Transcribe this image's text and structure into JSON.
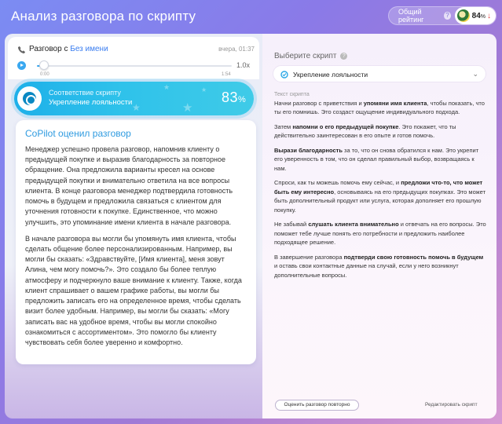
{
  "page": {
    "title": "Анализ разговора по скрипту",
    "rating_label": "Общий рейтинг",
    "rating_help": "?",
    "rating_value": "84",
    "rating_unit": "%",
    "rating_trend": "↓"
  },
  "player": {
    "label_prefix": "Разговор с",
    "contact": "Без имени",
    "timestamp": "вчера, 01:37",
    "speed": "1.0x",
    "time_start": "0:00",
    "time_end": "1:54",
    "progress": 0.02
  },
  "compliance": {
    "line1": "Соответствие скрипту",
    "line2": "Укрепление лояльности",
    "percent": "83",
    "unit": "%"
  },
  "copilot": {
    "title": "CoPilot оценил разговор",
    "paragraph1": "Менеджер успешно провела разговор, напомнив клиенту о предыдущей покупке и выразив благодарность за повторное обращение. Она предложила варианты кресел на основе предыдущей покупки и внимательно ответила на все вопросы клиента. В конце разговора менеджер подтвердила готовность помочь в будущем и предложила связаться с клиентом для уточнения готовности к покупке. Единственное, что можно улучшить, это упоминание имени клиента в начале разговора.",
    "paragraph2": "В начале разговора вы могли бы упомянуть имя клиента, чтобы сделать общение более персонализированным. Например, вы могли бы сказать: «Здравствуйте, [Имя клиента], меня зовут Алина, чем могу помочь?». Это создало бы более теплую атмосферу и подчеркнуло ваше внимание к клиенту. Также, когда клиент спрашивает о вашем графике работы, вы могли бы предложить записать его на определенное время, чтобы сделать визит более удобным. Например, вы могли бы сказать: «Могу записать вас на удобное время, чтобы вы могли спокойно ознакомиться с ассортиментом». Это помогло бы клиенту чувствовать себя более уверенно и комфортно."
  },
  "script": {
    "choose_label": "Выберите скрипт",
    "choose_help": "?",
    "selected": "Укрепление лояльности",
    "text_label": "Текст скрипта",
    "p1": {
      "a": "Начни разговор с приветствия и ",
      "b": "упомяни имя клиента",
      "c": ", чтобы показать, что ты его помнишь. Это создаст ощущение индивидуального подхода."
    },
    "p2": {
      "a": "Затем ",
      "b": "напомни о его предыдущей покупке",
      "c": ". Это покажет, что ты действительно заинтересован в его опыте и готов помочь."
    },
    "p3": {
      "a": "",
      "b": "Вырази благодарность",
      "c": " за то, что он снова обратился к нам. Это укрепит его уверенность в том, что он сделал правильный выбор, возвращаясь к нам."
    },
    "p4": {
      "a": "Спроси, как ты можешь помочь ему сейчас, и ",
      "b": "предложи что-то, что может быть ему интересно",
      "c": ", основываясь на его предыдущих покупках. Это может быть дополнительный продукт или услуга, которая дополняет его прошлую покупку."
    },
    "p5": {
      "a": "Не забывай ",
      "b": "слушать клиента внимательно",
      "c": " и отвечать на его вопросы. Это поможет тебе лучше понять его потребности и предложить наиболее подходящее решение."
    },
    "p6": {
      "a": "В завершение разговора ",
      "b": "подтверди свою готовность помочь в будущем",
      "c": " и оставь свои контактные данные на случай, если у него возникнут дополнительные вопросы."
    },
    "reevaluate_label": "Оценить разговор повторно",
    "edit_label": "Редактировать скрипт"
  },
  "colors": {
    "accent_blue": "#2f9be0",
    "banner_cyan": "#1eb0e9",
    "trend_down": "#e23b3b"
  },
  "icons": [
    "phone-icon",
    "play-icon",
    "script-compliance-icon",
    "script-icon",
    "chevron-down-icon",
    "help-icon",
    "trend-down-icon"
  ]
}
